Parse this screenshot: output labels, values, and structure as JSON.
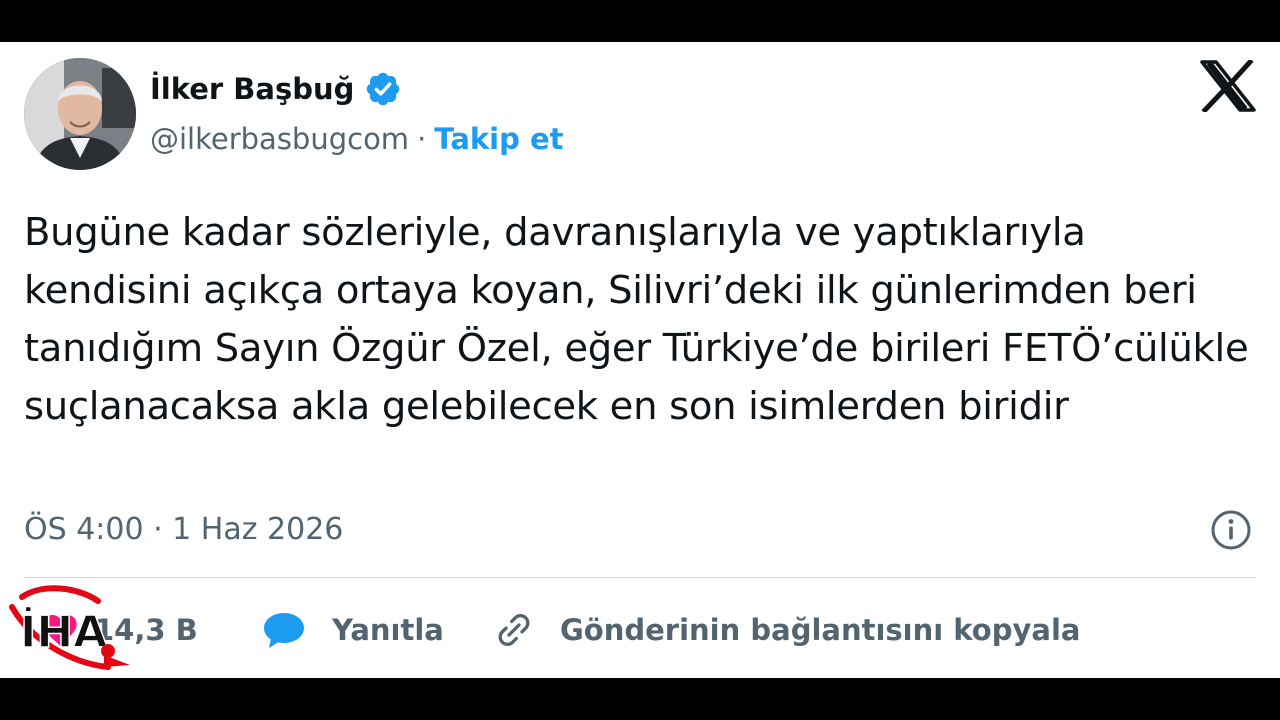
{
  "user": {
    "display_name": "İlker Başbuğ",
    "handle": "@ilkerbasbugcom",
    "separator": "·",
    "follow_label": "Takip et"
  },
  "tweet": {
    "text": "Bugüne kadar sözleriyle, davranışlarıyla ve yaptıklarıyla kendisini açıkça ortaya koyan, Silivri’deki ilk günlerimden beri tanıdığım Sayın Özgür Özel, eğer Türkiye’de birileri FETÖ’cülükle suçlanacaksa akla gelebilecek en son isimlerden biridir",
    "timestamp": "ÖS 4:00 · 1 Haz 2026"
  },
  "actions": {
    "like_count": "14,3 B",
    "reply_label": "Yanıtla",
    "copy_link_label": "Gönderinin bağlantısını kopyala"
  },
  "watermark": {
    "text": "İHA"
  },
  "colors": {
    "accent": "#1d9bf0",
    "text_primary": "#0f1419",
    "text_secondary": "#536471",
    "like": "#f91880",
    "watermark_red": "#e30613",
    "frame": "#000000"
  },
  "icons": {
    "verified": "verified-badge-icon",
    "platform": "x-logo-icon",
    "info": "info-icon",
    "like": "heart-icon",
    "reply": "reply-bubble-icon",
    "copy_link": "link-icon"
  }
}
